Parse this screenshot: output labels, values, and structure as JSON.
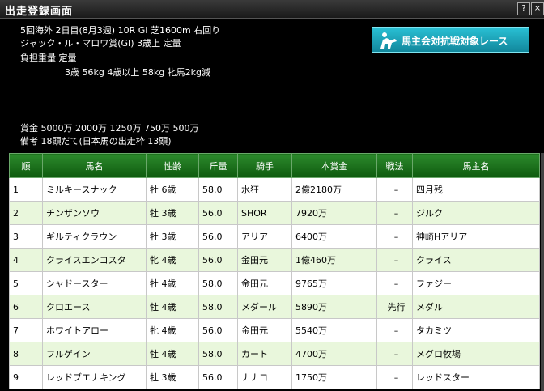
{
  "window": {
    "title": "出走登録画面",
    "help_label": "?",
    "close_label": "×"
  },
  "race": {
    "line1": "5回海外 2日目(8月3週) 10R GI 芝1600m 右回り",
    "line2": "ジャック・ル・マロワ賞(GI) 3歳上 定量",
    "line3": "負担重量 定量",
    "line4": "3歳 56kg 4歳以上 58kg 牝馬2kg減",
    "prize": "賞金 5000万 2000万 1250万 750万 500万",
    "note": "備考 18頭だて(日本馬の出走枠 13頭)"
  },
  "banner": {
    "label": "馬主会対抗戦対象レース",
    "icon": "horse-rider-icon"
  },
  "table": {
    "headers": [
      "順",
      "馬名",
      "性齢",
      "斤量",
      "騎手",
      "本賞金",
      "戦法",
      "馬主名"
    ],
    "rows": [
      [
        "1",
        "ミルキースナック",
        "牡 6歳",
        "58.0",
        "水狂",
        "2億2180万",
        "–",
        "四月残"
      ],
      [
        "2",
        "チンザンソウ",
        "牡 3歳",
        "56.0",
        "SHOR",
        "7920万",
        "–",
        "ジルク"
      ],
      [
        "3",
        "ギルティクラウン",
        "牡 3歳",
        "56.0",
        "アリア",
        "6400万",
        "–",
        "神崎Hアリア"
      ],
      [
        "4",
        "クライスエンコスタ",
        "牝 4歳",
        "56.0",
        "金田元",
        "1億460万",
        "–",
        "クライス"
      ],
      [
        "5",
        "シャドースター",
        "牡 4歳",
        "58.0",
        "金田元",
        "9765万",
        "–",
        "ファジー"
      ],
      [
        "6",
        "クロエース",
        "牡 4歳",
        "58.0",
        "メダール",
        "5890万",
        "先行",
        "メダル"
      ],
      [
        "7",
        "ホワイトアロー",
        "牝 4歳",
        "56.0",
        "金田元",
        "5540万",
        "–",
        "タカミツ"
      ],
      [
        "8",
        "フルゲイン",
        "牡 4歳",
        "58.0",
        "カート",
        "4700万",
        "–",
        "メグロ牧場"
      ],
      [
        "9",
        "レッドブエナキング",
        "牡 3歳",
        "56.0",
        "ナナコ",
        "1750万",
        "–",
        "レッドスター"
      ]
    ]
  }
}
